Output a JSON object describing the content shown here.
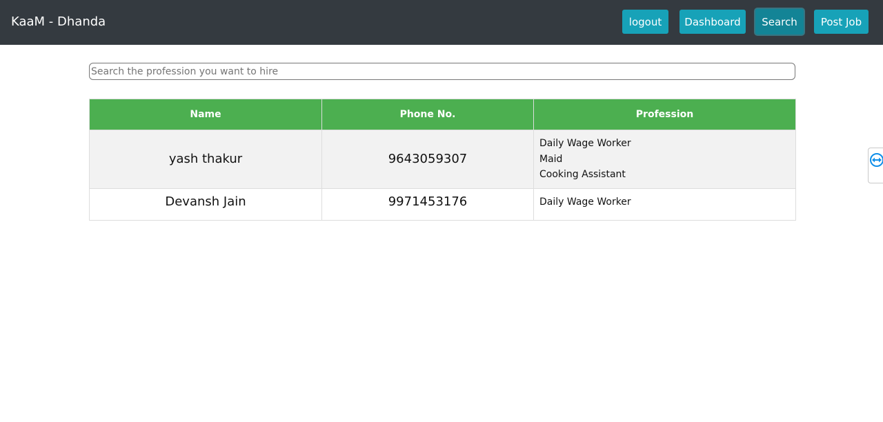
{
  "navbar": {
    "brand": "KaaM - Dhanda",
    "buttons": {
      "logout": "logout",
      "dashboard": "Dashboard",
      "search": "Search",
      "post_job": "Post Job"
    }
  },
  "search": {
    "placeholder": "Search the profession you want to hire",
    "value": ""
  },
  "table": {
    "headers": {
      "name": "Name",
      "phone": "Phone No.",
      "profession": "Profession"
    },
    "rows": [
      {
        "name": "yash thakur",
        "phone": "9643059307",
        "professions": [
          "Daily Wage Worker",
          "Maid",
          "Cooking Assistant"
        ]
      },
      {
        "name": "Devansh Jain",
        "phone": "9971453176",
        "professions": [
          "Daily Wage Worker"
        ]
      }
    ]
  },
  "side_widget": {
    "icon": "teamviewer-arrows-icon"
  },
  "colors": {
    "navbar_bg": "#343a40",
    "button_bg": "#17a2b8",
    "header_green": "#4caf50",
    "row_stripe": "#f2f2f2",
    "widget_blue": "#0e8ee9"
  }
}
